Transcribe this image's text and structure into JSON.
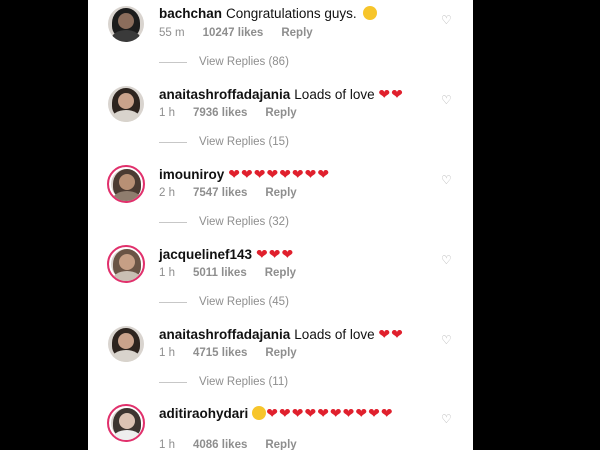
{
  "colors": {
    "heart": "#e0202d",
    "muted": "#8e8e8e",
    "story_ring": "#e1306c"
  },
  "comments": [
    {
      "username": "bachchan",
      "text": "Congratulations guys. ",
      "time": "55 m",
      "likes": "10247 likes",
      "reply": "Reply",
      "view_replies": "View Replies (86)"
    },
    {
      "username": "anaitashroffadajania",
      "text": "Loads of love ",
      "hearts": "❤❤",
      "time": "1 h",
      "likes": "7936 likes",
      "reply": "Reply",
      "view_replies": "View Replies (15)"
    },
    {
      "username": "imouniroy",
      "text": "",
      "hearts": "❤❤❤❤❤❤❤❤",
      "time": "2 h",
      "likes": "7547 likes",
      "reply": "Reply",
      "view_replies": "View Replies (32)"
    },
    {
      "username": "jacquelinef143",
      "text": "",
      "hearts": "❤❤❤",
      "time": "1 h",
      "likes": "5011 likes",
      "reply": "Reply",
      "view_replies": "View Replies (45)"
    },
    {
      "username": "anaitashroffadajania",
      "text": "Loads of love ",
      "hearts": "❤❤",
      "time": "1 h",
      "likes": "4715 likes",
      "reply": "Reply",
      "view_replies": "View Replies (11)"
    },
    {
      "username": "aditiraohydari",
      "text": "",
      "hearts": "❤❤❤❤❤❤❤❤❤❤",
      "time": "1 h",
      "likes": "4086 likes",
      "reply": "Reply"
    }
  ]
}
